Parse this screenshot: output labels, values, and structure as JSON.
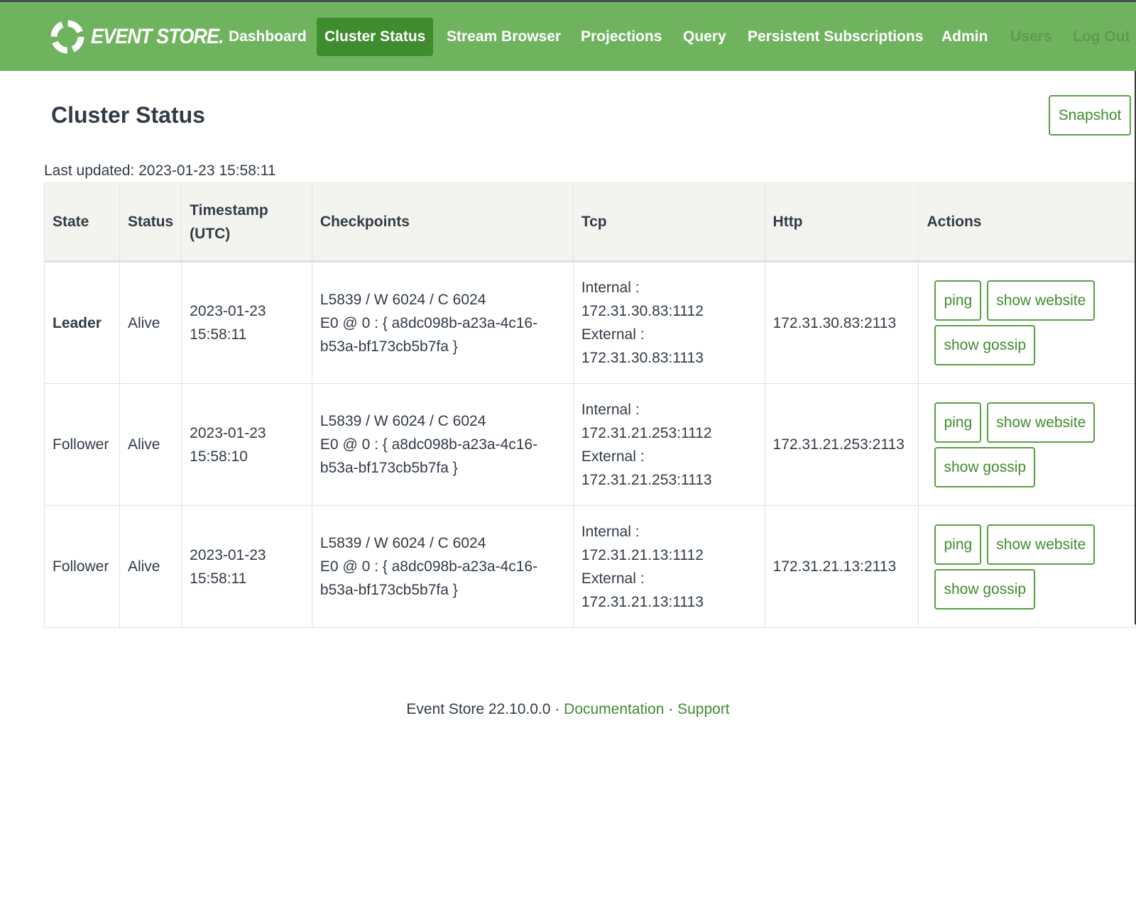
{
  "brand": {
    "logo_text": "EVENT STORE."
  },
  "nav": {
    "items": [
      {
        "label": "Dashboard"
      },
      {
        "label": "Cluster Status"
      },
      {
        "label": "Stream Browser"
      },
      {
        "label": "Projections"
      },
      {
        "label": "Query"
      },
      {
        "label": "Persistent Subscriptions"
      },
      {
        "label": "Admin"
      },
      {
        "label": "Users"
      },
      {
        "label": "Log Out"
      }
    ],
    "active": "Cluster Status"
  },
  "page": {
    "title": "Cluster Status",
    "snapshot_label": "Snapshot",
    "last_updated": "Last updated: 2023-01-23 15:58:11"
  },
  "table": {
    "headers": [
      "State",
      "Status",
      "Timestamp",
      "(UTC)",
      "Checkpoints",
      "Tcp",
      "Http",
      "Actions"
    ],
    "rows": [
      {
        "state": "Leader",
        "status": "Alive",
        "date": "2023-01-23",
        "time": "15:58:11",
        "checkpoint_1": "L5839 / W 6024 / C 6024",
        "checkpoint_2": "E0 @ 0 : { a8dc098b-a23a-4c16-",
        "checkpoint_3": "b53a-bf173cb5b7fa }",
        "tcp_internal_label": "Internal :",
        "tcp_internal": "172.31.30.83:1112",
        "tcp_external_label": "External :",
        "tcp_external": "172.31.30.83:1113",
        "http": "172.31.30.83:2113",
        "ping": "ping",
        "show_website": "show website",
        "show_gossip": "show gossip"
      },
      {
        "state": "Follower",
        "status": "Alive",
        "date": "2023-01-23",
        "time": "15:58:10",
        "checkpoint_1": "L5839 / W 6024 / C 6024",
        "checkpoint_2": "E0 @ 0 : { a8dc098b-a23a-4c16-",
        "checkpoint_3": "b53a-bf173cb5b7fa }",
        "tcp_internal_label": "Internal :",
        "tcp_internal": "172.31.21.253:1112",
        "tcp_external_label": "External :",
        "tcp_external": "172.31.21.253:1113",
        "http": "172.31.21.253:2113",
        "ping": "ping",
        "show_website": "show website",
        "show_gossip": "show gossip"
      },
      {
        "state": "Follower",
        "status": "Alive",
        "date": "2023-01-23",
        "time": "15:58:11",
        "checkpoint_1": "L5839 / W 6024 / C 6024",
        "checkpoint_2": "E0 @ 0 : { a8dc098b-a23a-4c16-",
        "checkpoint_3": "b53a-bf173cb5b7fa }",
        "tcp_internal_label": "Internal :",
        "tcp_internal": "172.31.21.13:1112",
        "tcp_external_label": "External :",
        "tcp_external": "172.31.21.13:1113",
        "http": "172.31.21.13:2113",
        "ping": "ping",
        "show_website": "show website",
        "show_gossip": "show gossip"
      }
    ]
  },
  "footer": {
    "version": "Event Store 22.10.0.0",
    "separator": "·",
    "documentation": "Documentation",
    "support": "Support"
  },
  "colors": {
    "topbar": "#70b35f",
    "active_nav": "#3f8c2f",
    "accent": "#3f8c2f",
    "text": "#323b46",
    "header_bg": "#f3f4f0"
  }
}
